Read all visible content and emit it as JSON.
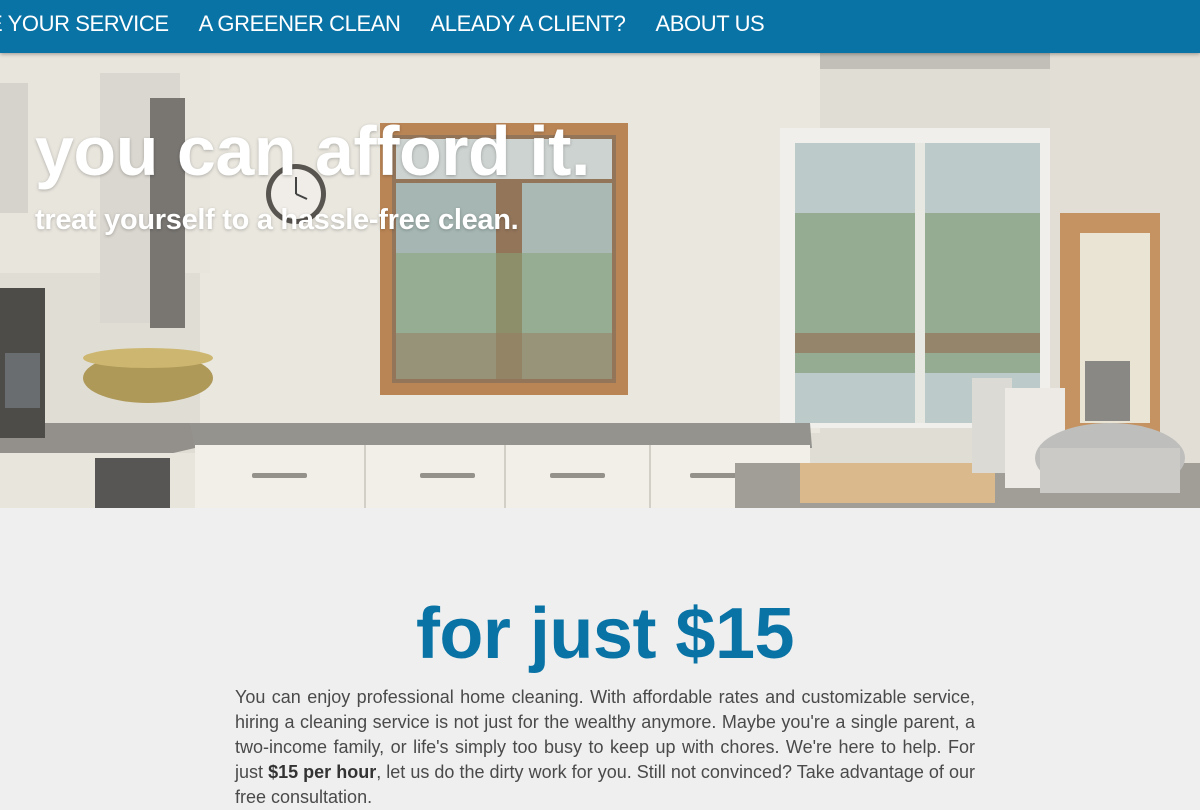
{
  "nav": {
    "items": [
      {
        "label": "E YOUR SERVICE"
      },
      {
        "label": "A GREENER CLEAN"
      },
      {
        "label": "ALEADY A CLIENT?"
      },
      {
        "label": "ABOUT US"
      }
    ]
  },
  "hero": {
    "title": "you can afford it.",
    "subtitle": "treat yourself to a hassle-free clean."
  },
  "main": {
    "heading": "for just $15",
    "paragraph_before": "You can enjoy professional home cleaning. With affordable rates and customizable service, hiring a cleaning service is not just for the wealthy anymore. Maybe you're a single parent, a two-income family, or life's simply too busy to keep up with chores. We're here to help. For just ",
    "paragraph_bold": "$15 per hour",
    "paragraph_after": ", let us do the dirty work for you. Still not convinced? Take advantage of our free consultation."
  },
  "colors": {
    "brand_blue": "#0a73a6",
    "page_background": "#efefef"
  }
}
